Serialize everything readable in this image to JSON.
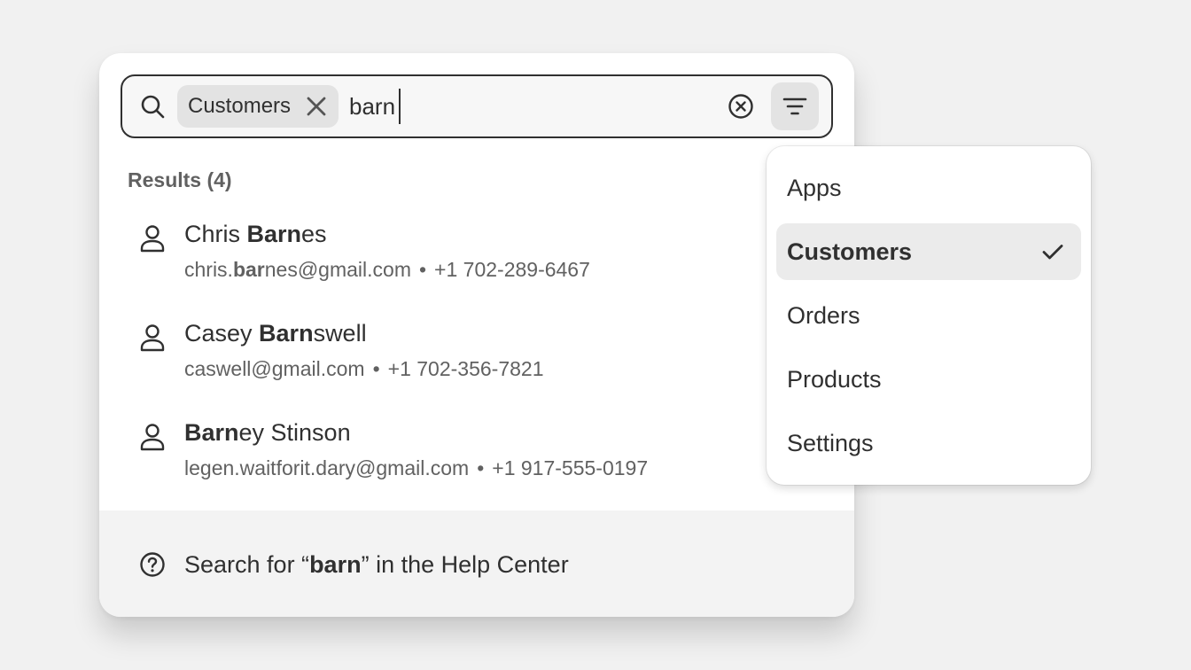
{
  "search": {
    "chip_label": "Customers",
    "query": "barn",
    "placeholder": ""
  },
  "results": {
    "heading": "Results (4)",
    "items": [
      {
        "name_before": "Chris ",
        "name_match": "Barn",
        "name_after": "es",
        "email_before": "chris.",
        "email_match": "bar",
        "email_after": "nes@gmail.com",
        "phone": "+1 702-289-6467"
      },
      {
        "name_before": "Casey ",
        "name_match": "Barn",
        "name_after": "swell",
        "email_before": "caswell@gmail.com",
        "email_match": "",
        "email_after": "",
        "phone": "+1 702-356-7821"
      },
      {
        "name_before": "",
        "name_match": "Barn",
        "name_after": "ey Stinson",
        "email_before": "legen.waitforit.dary@gmail.com",
        "email_match": "",
        "email_after": "",
        "phone": "+1 917-555-0197"
      }
    ],
    "separator": "•"
  },
  "footer": {
    "before": "Search for “",
    "query": "barn",
    "after": "” in the Help Center"
  },
  "filter_menu": {
    "items": [
      {
        "label": "Apps",
        "selected": false
      },
      {
        "label": "Customers",
        "selected": true
      },
      {
        "label": "Orders",
        "selected": false
      },
      {
        "label": "Products",
        "selected": false
      },
      {
        "label": "Settings",
        "selected": false
      }
    ]
  },
  "colors": {
    "text": "#303030",
    "subdued": "#616161",
    "chip_bg": "#e3e3e3",
    "selected_bg": "#ebebeb",
    "page_bg": "#f1f1f1"
  },
  "icons": {
    "search": "search-icon",
    "chip_close": "x-icon",
    "clear": "circle-x-icon",
    "filter": "filter-lines-icon",
    "result": "person-icon",
    "help": "question-circle-icon",
    "selected": "check-icon"
  }
}
